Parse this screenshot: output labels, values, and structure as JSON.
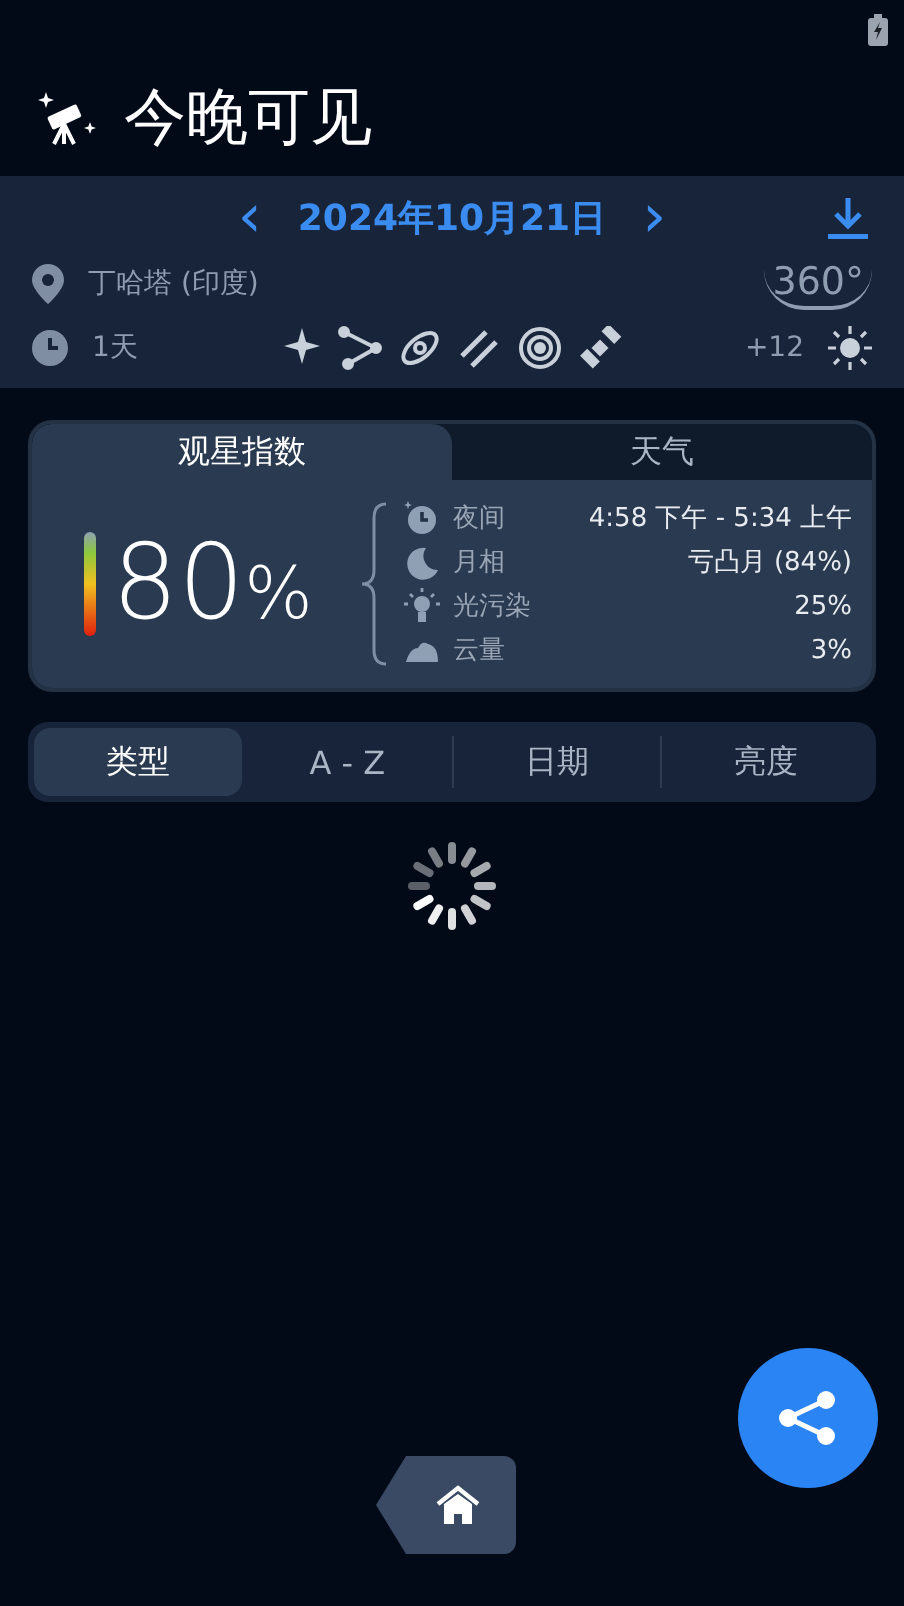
{
  "title": "今晚可见",
  "date": {
    "prev": "‹",
    "label": "2024年10月21日",
    "next": "›"
  },
  "location": "丁哈塔 (印度)",
  "view_badge": "360°",
  "duration": "1天",
  "magnitude": "+12",
  "tabs": [
    {
      "label": "观星指数",
      "selected": true
    },
    {
      "label": "天气",
      "selected": false
    }
  ],
  "score": "80",
  "score_unit": "%",
  "conditions": [
    {
      "kind": "night",
      "label": "夜间",
      "value": "4:58 下午 - 5:34 上午"
    },
    {
      "kind": "moon",
      "label": "月相",
      "value": "亏凸月 (84%)"
    },
    {
      "kind": "light",
      "label": "光污染",
      "value": "25%"
    },
    {
      "kind": "cloud",
      "label": "云量",
      "value": "3%"
    }
  ],
  "sort_tabs": [
    {
      "label": "类型",
      "selected": true
    },
    {
      "label": "A - Z",
      "selected": false
    },
    {
      "label": "日期",
      "selected": false
    },
    {
      "label": "亮度",
      "selected": false
    }
  ]
}
